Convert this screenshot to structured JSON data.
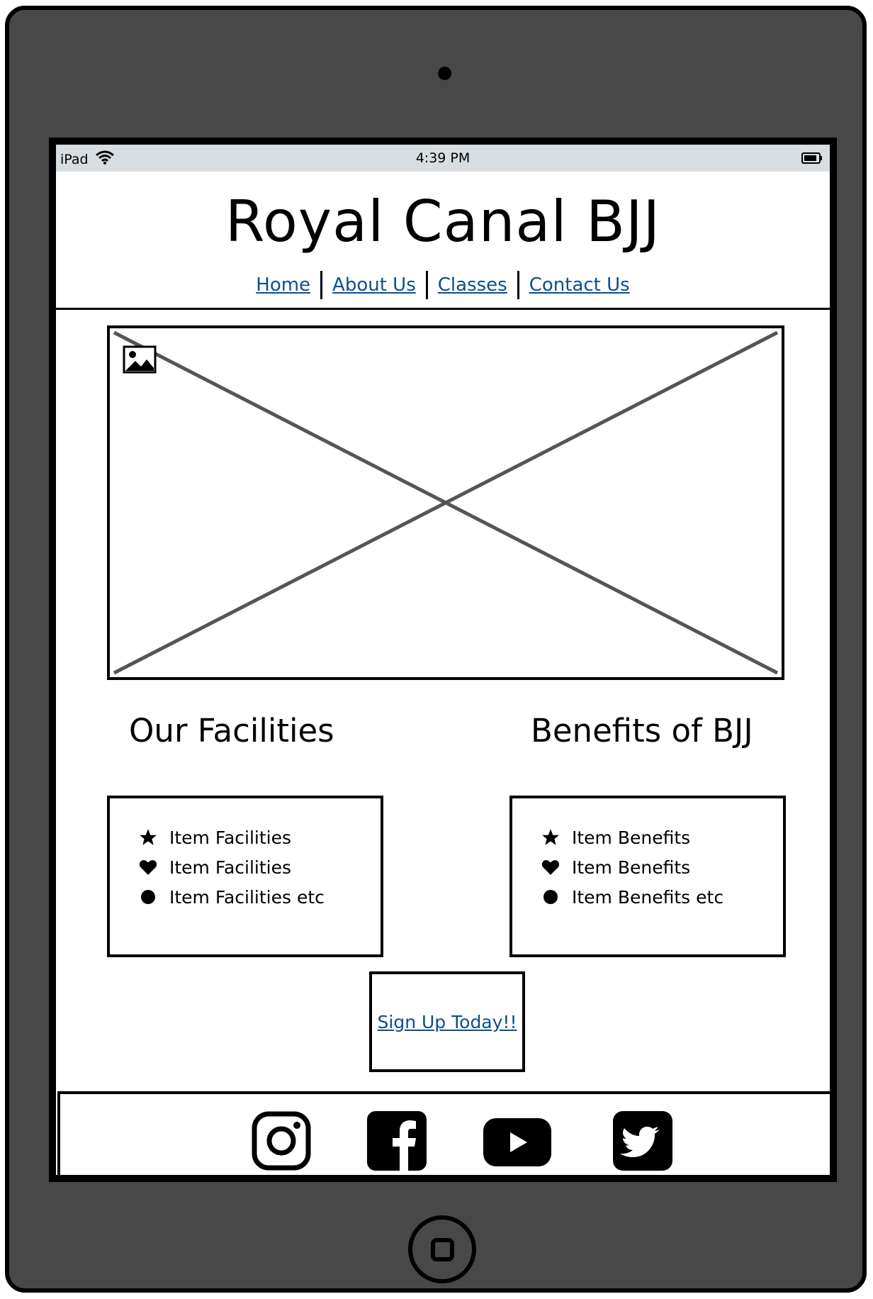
{
  "status_bar": {
    "device": "iPad",
    "time": "4:39 PM"
  },
  "site": {
    "title": "Royal Canal BJJ"
  },
  "nav": {
    "items": [
      "Home",
      "About Us",
      "Classes",
      "Contact Us"
    ]
  },
  "sections": {
    "facilities": {
      "heading": "Our Facilities",
      "items": [
        "Item Facilities",
        "Item Facilities",
        "Item Facilities etc"
      ]
    },
    "benefits": {
      "heading": "Benefits of BJJ",
      "items": [
        "Item Benefits",
        "Item Benefits",
        "Item Benefits etc"
      ]
    }
  },
  "cta": {
    "label": "Sign Up Today!!"
  },
  "footer": {
    "icons": [
      "instagram-icon",
      "facebook-icon",
      "youtube-icon",
      "twitter-icon"
    ]
  },
  "colors": {
    "link": "#0b4f8f",
    "device": "#484848",
    "status_bar": "#d7dde0"
  }
}
